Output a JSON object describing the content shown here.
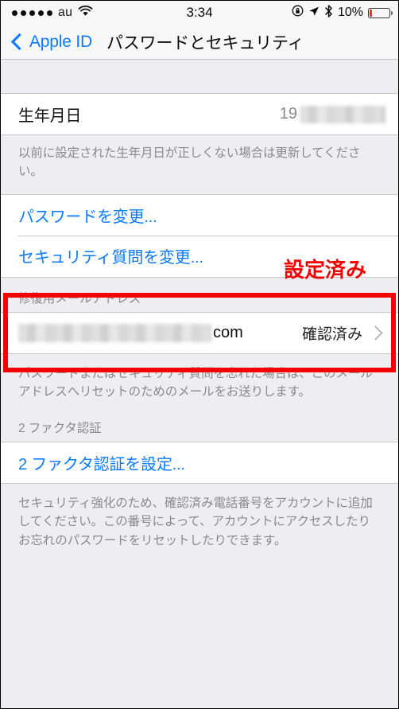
{
  "statusbar": {
    "signal_dots": 5,
    "carrier": "au",
    "wifi_icon": "wifi-icon",
    "time": "3:34",
    "rotation_lock_icon": "rotation-lock-icon",
    "location_icon": "location-arrow-icon",
    "bluetooth_icon": "bluetooth-icon",
    "battery_percent": "10%",
    "battery_level": 10,
    "battery_color": "#ff2a18"
  },
  "navbar": {
    "back_label": "Apple ID",
    "back_icon": "chevron-left-icon",
    "title": "パスワードとセキュリティ"
  },
  "sections": {
    "birthdate": {
      "label": "生年月日",
      "value_prefix": "19",
      "value_redacted": true,
      "footer": "以前に設定された生年月日が正しくない場合は更新してください。"
    },
    "actions": {
      "change_password": "パスワードを変更...",
      "change_security_questions": "セキュリティ質問を変更..."
    },
    "recovery_email": {
      "header": "修復用メールアドレス",
      "email_redacted": true,
      "email_suffix": "com",
      "status": "確認済み",
      "disclosure_icon": "chevron-right-icon",
      "footer": "パスワードまたはセキュリティ質問を忘れた場合は、このメールアドレスへリセットのためのメールをお送りします。"
    },
    "two_factor": {
      "header": "2 ファクタ認証",
      "setup_link": "2 ファクタ認証を設定...",
      "footer": "セキュリティ強化のため、確認済み電話番号をアカウントに追加してください。この番号によって、アカウントにアクセスしたりお忘れのパスワードをリセットしたりできます。"
    }
  },
  "annotations": {
    "already_set_label": "設定済み",
    "color": "#f50000",
    "highlight_box": "recovery-email-section"
  }
}
